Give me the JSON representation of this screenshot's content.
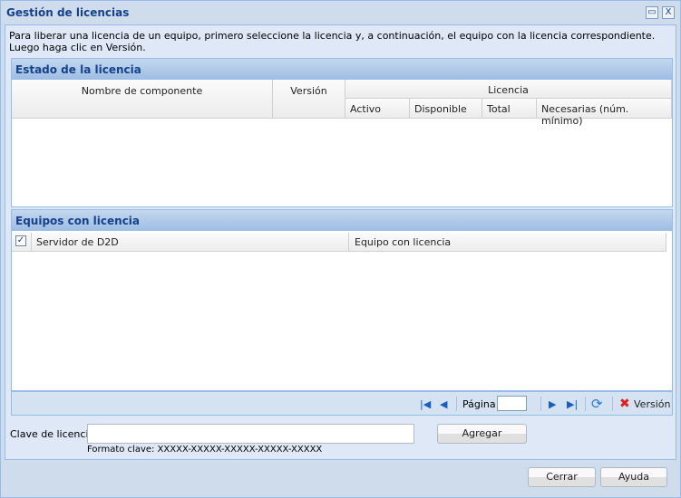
{
  "window": {
    "title": "Gestión de licencias"
  },
  "instructions": "Para liberar una licencia de un equipo, primero seleccione la licencia y, a continuación, el equipo con la licencia correspondiente. Luego haga clic en Versión.",
  "license_status": {
    "title": "Estado de la licencia",
    "columns": {
      "component": "Nombre de componente",
      "version": "Versión",
      "license": "Licencia",
      "active": "Activo",
      "available": "Disponible",
      "total": "Total",
      "required": "Necesarias (núm. mínimo)"
    }
  },
  "licensed_machines": {
    "title": "Equipos con licencia",
    "columns": {
      "server": "Servidor de D2D",
      "machine": "Equipo con licencia"
    },
    "select_all_checked": true
  },
  "pager": {
    "page_label": "Página",
    "page_value": "",
    "release_label": "Versión"
  },
  "license_key": {
    "label": "Clave de licencia",
    "value": "",
    "format": "Formato clave: XXXXX-XXXXX-XXXXX-XXXXX-XXXXX",
    "add_label": "Agregar"
  },
  "footer": {
    "close_label": "Cerrar",
    "help_label": "Ayuda"
  }
}
